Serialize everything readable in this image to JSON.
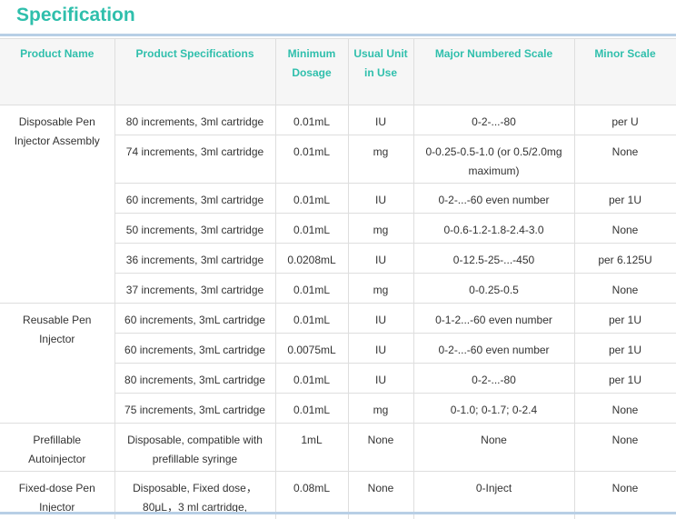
{
  "title": "Specification",
  "headers": [
    "Product Name",
    "Product Specifications",
    "Minimum Dosage",
    "Usual Unit in Use",
    "Major Numbered Scale",
    "Minor Scale"
  ],
  "groups": [
    {
      "name": "Disposable Pen Injector Assembly",
      "rows": [
        {
          "spec": "80 increments, 3ml cartridge",
          "dose": "0.01mL",
          "unit": "IU",
          "major": "0-2-...-80",
          "minor": "per U"
        },
        {
          "spec": "74 increments, 3ml cartridge",
          "dose": "0.01mL",
          "unit": "mg",
          "major": "0-0.25-0.5-1.0  (or 0.5/2.0mg maximum)",
          "minor": "None"
        },
        {
          "spec": "60 increments, 3ml cartridge",
          "dose": "0.01mL",
          "unit": "IU",
          "major": "0-2-...-60 even number",
          "minor": "per 1U"
        },
        {
          "spec": "50 increments, 3ml cartridge",
          "dose": "0.01mL",
          "unit": "mg",
          "major": "0-0.6-1.2-1.8-2.4-3.0",
          "minor": "None"
        },
        {
          "spec": "36 increments, 3ml cartridge",
          "dose": "0.0208mL",
          "unit": "IU",
          "major": "0-12.5-25-...-450",
          "minor": "per 6.125U"
        },
        {
          "spec": "37 increments, 3ml cartridge",
          "dose": "0.01mL",
          "unit": "mg",
          "major": "0-0.25-0.5",
          "minor": "None"
        }
      ]
    },
    {
      "name": "Reusable Pen Injector",
      "rows": [
        {
          "spec": "60 increments, 3mL cartridge",
          "dose": "0.01mL",
          "unit": "IU",
          "major": "0-1-2...-60 even number",
          "minor": "per 1U"
        },
        {
          "spec": "60 increments, 3mL cartridge",
          "dose": "0.0075mL",
          "unit": "IU",
          "major": "0-2-...-60 even number",
          "minor": "per 1U"
        },
        {
          "spec": "80 increments, 3mL cartridge",
          "dose": "0.01mL",
          "unit": "IU",
          "major": "0-2-...-80",
          "minor": "per 1U"
        },
        {
          "spec": "75 increments, 3mL cartridge",
          "dose": "0.01mL",
          "unit": "mg",
          "major": "0-1.0; 0-1.7; 0-2.4",
          "minor": "None"
        }
      ]
    },
    {
      "name": "Prefillable Autoinjector",
      "rows": [
        {
          "spec": "Disposable, compatible with prefillable syringe",
          "dose": "1mL",
          "unit": "None",
          "major": "None",
          "minor": "None"
        }
      ]
    },
    {
      "name": "Fixed-dose Pen Injector",
      "rows": [
        {
          "spec": "Disposable, Fixed dose，80μL，3 ml cartridge,",
          "dose": "0.08mL",
          "unit": "None",
          "major": "0-Inject",
          "minor": "None"
        }
      ]
    }
  ],
  "colors": {
    "accent": "#2fbfac",
    "rule": "#b8cfe6",
    "header_bg": "#f6f6f6",
    "border": "#dedede"
  }
}
